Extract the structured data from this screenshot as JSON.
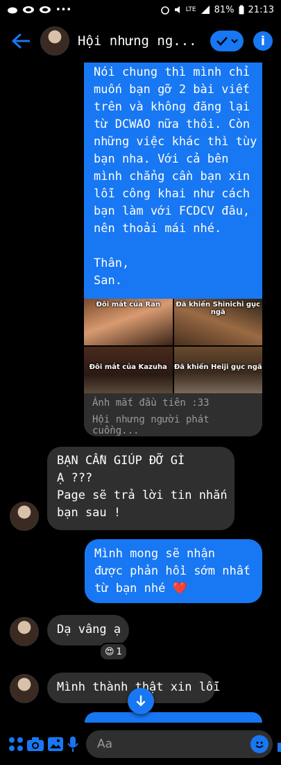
{
  "status": {
    "battery": "81%",
    "time": "21:13",
    "network": "LTE"
  },
  "header": {
    "title": "Hội nhưng ng..."
  },
  "messages": {
    "long_sent": [
      "Nói chung thì mình chỉ",
      "muốn bạn gỡ 2 bài viết",
      "trên và không đăng lại",
      "từ DCWAO nữa thôi. Còn",
      "những việc khác thì tùy",
      "bạn nha. Với cả bên",
      "mình chẳng cần bạn xin",
      "lỗi công khai như cách",
      "bạn làm với FCDCV đâu,",
      "nên thoải mái nhé.",
      "",
      "Thân,",
      "San."
    ],
    "image_captions": [
      "Đôi mắt của Ran",
      "Đã khiến Shinichi gục ngã",
      "Đôi mắt của Kazuha",
      "Đã khiến Heiji gục ngã"
    ],
    "link_title": "Ánh mắt đầu tiên :33",
    "link_subtitle": "Hội nhưng người phát cuồng...",
    "page_reply": [
      "BẠN CẦN GIÚP ĐỠ GÌ",
      "Ạ ???",
      "Page sẽ trả lời tin nhắn",
      "bạn sau !"
    ],
    "sent_hope": [
      "Mình mong sẽ nhận",
      "được phản hồi sớm nhất",
      "từ bạn nhé ❤️"
    ],
    "reply_yes": "Dạ vâng ạ",
    "reaction_count": "1",
    "reply_sorry": "Mình thành thật xin lỗi"
  },
  "composer": {
    "placeholder": "Aa"
  },
  "colors": {
    "accent": "#1877f2",
    "bubble_in": "#2f2f2f",
    "background": "#000000"
  }
}
